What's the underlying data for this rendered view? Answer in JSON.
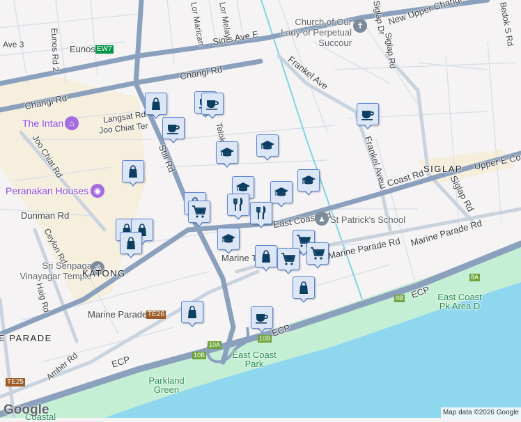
{
  "map": {
    "roads": [
      "Changi Rd",
      "Changi Rd",
      "Sims Ave E",
      "New Upper Changi",
      "Frankel Ave",
      "Frankel Ave",
      "Siglap Rd",
      "Siglap Rd",
      "Upper E Coast",
      "E Coast Rd",
      "East Coast Rd",
      "Marine Parade Rd",
      "Marine Parade Rd",
      "Still Rd",
      "Joo Chiat Rd",
      "Eunos Rd 2",
      "Langsat Rd",
      "Joo Chiat Ter",
      "Dunman Rd",
      "Ceylon Rd",
      "Haig Rd",
      "Amber Rd",
      "ECP",
      "ECP",
      "ECP",
      "Ave 3",
      "Lor Marican",
      "Lor Melayu",
      "Telok",
      "Bedok S Rd",
      "Siglap Dr",
      "Marine T"
    ],
    "pois": [
      "The Intan",
      "Peranakan Houses",
      "Church of Our Lady of Perpetual Succour",
      "St Patrick's School",
      "Sri Senpaga Vinayagar Temple"
    ],
    "areas": [
      "KATONG",
      "SIGLAP",
      "E PARADE"
    ],
    "parks": [
      "East Coast Park",
      "Parkland Green",
      "East Coast Pk Area D",
      "Coastal"
    ],
    "stations": [
      {
        "name": "Eunos",
        "code": "EW7",
        "color": "#009645"
      },
      {
        "name": "Marine Parade",
        "code": "TE26",
        "color": "#9d5b25"
      },
      {
        "name": "",
        "code": "TE25",
        "color": "#9d5b25"
      }
    ],
    "exits": [
      "10A",
      "10B",
      "10B",
      "8B",
      "8A"
    ],
    "attribution": "Map data ©2026 Google",
    "logo": "Google"
  },
  "markers": [
    {
      "type": "shop"
    },
    {
      "type": "cafe"
    },
    {
      "type": "cafe"
    },
    {
      "type": "cafe"
    },
    {
      "type": "education"
    },
    {
      "type": "education"
    },
    {
      "type": "shop"
    },
    {
      "type": "cafe"
    },
    {
      "type": "education"
    },
    {
      "type": "education"
    },
    {
      "type": "education"
    },
    {
      "type": "shop"
    },
    {
      "type": "grocery"
    },
    {
      "type": "restaurant"
    },
    {
      "type": "restaurant"
    },
    {
      "type": "shop"
    },
    {
      "type": "shop"
    },
    {
      "type": "shop"
    },
    {
      "type": "education"
    },
    {
      "type": "grocery"
    },
    {
      "type": "grocery"
    },
    {
      "type": "shop"
    },
    {
      "type": "grocery"
    },
    {
      "type": "shop"
    },
    {
      "type": "shop"
    },
    {
      "type": "cafe"
    }
  ],
  "colors": {
    "marker_fill": "#dde6f7",
    "marker_border": "#5b86d3",
    "icon": "#0d3f63",
    "water": "#8fd7ef",
    "park": "#c5efd5",
    "road": "#8aa0bc"
  }
}
